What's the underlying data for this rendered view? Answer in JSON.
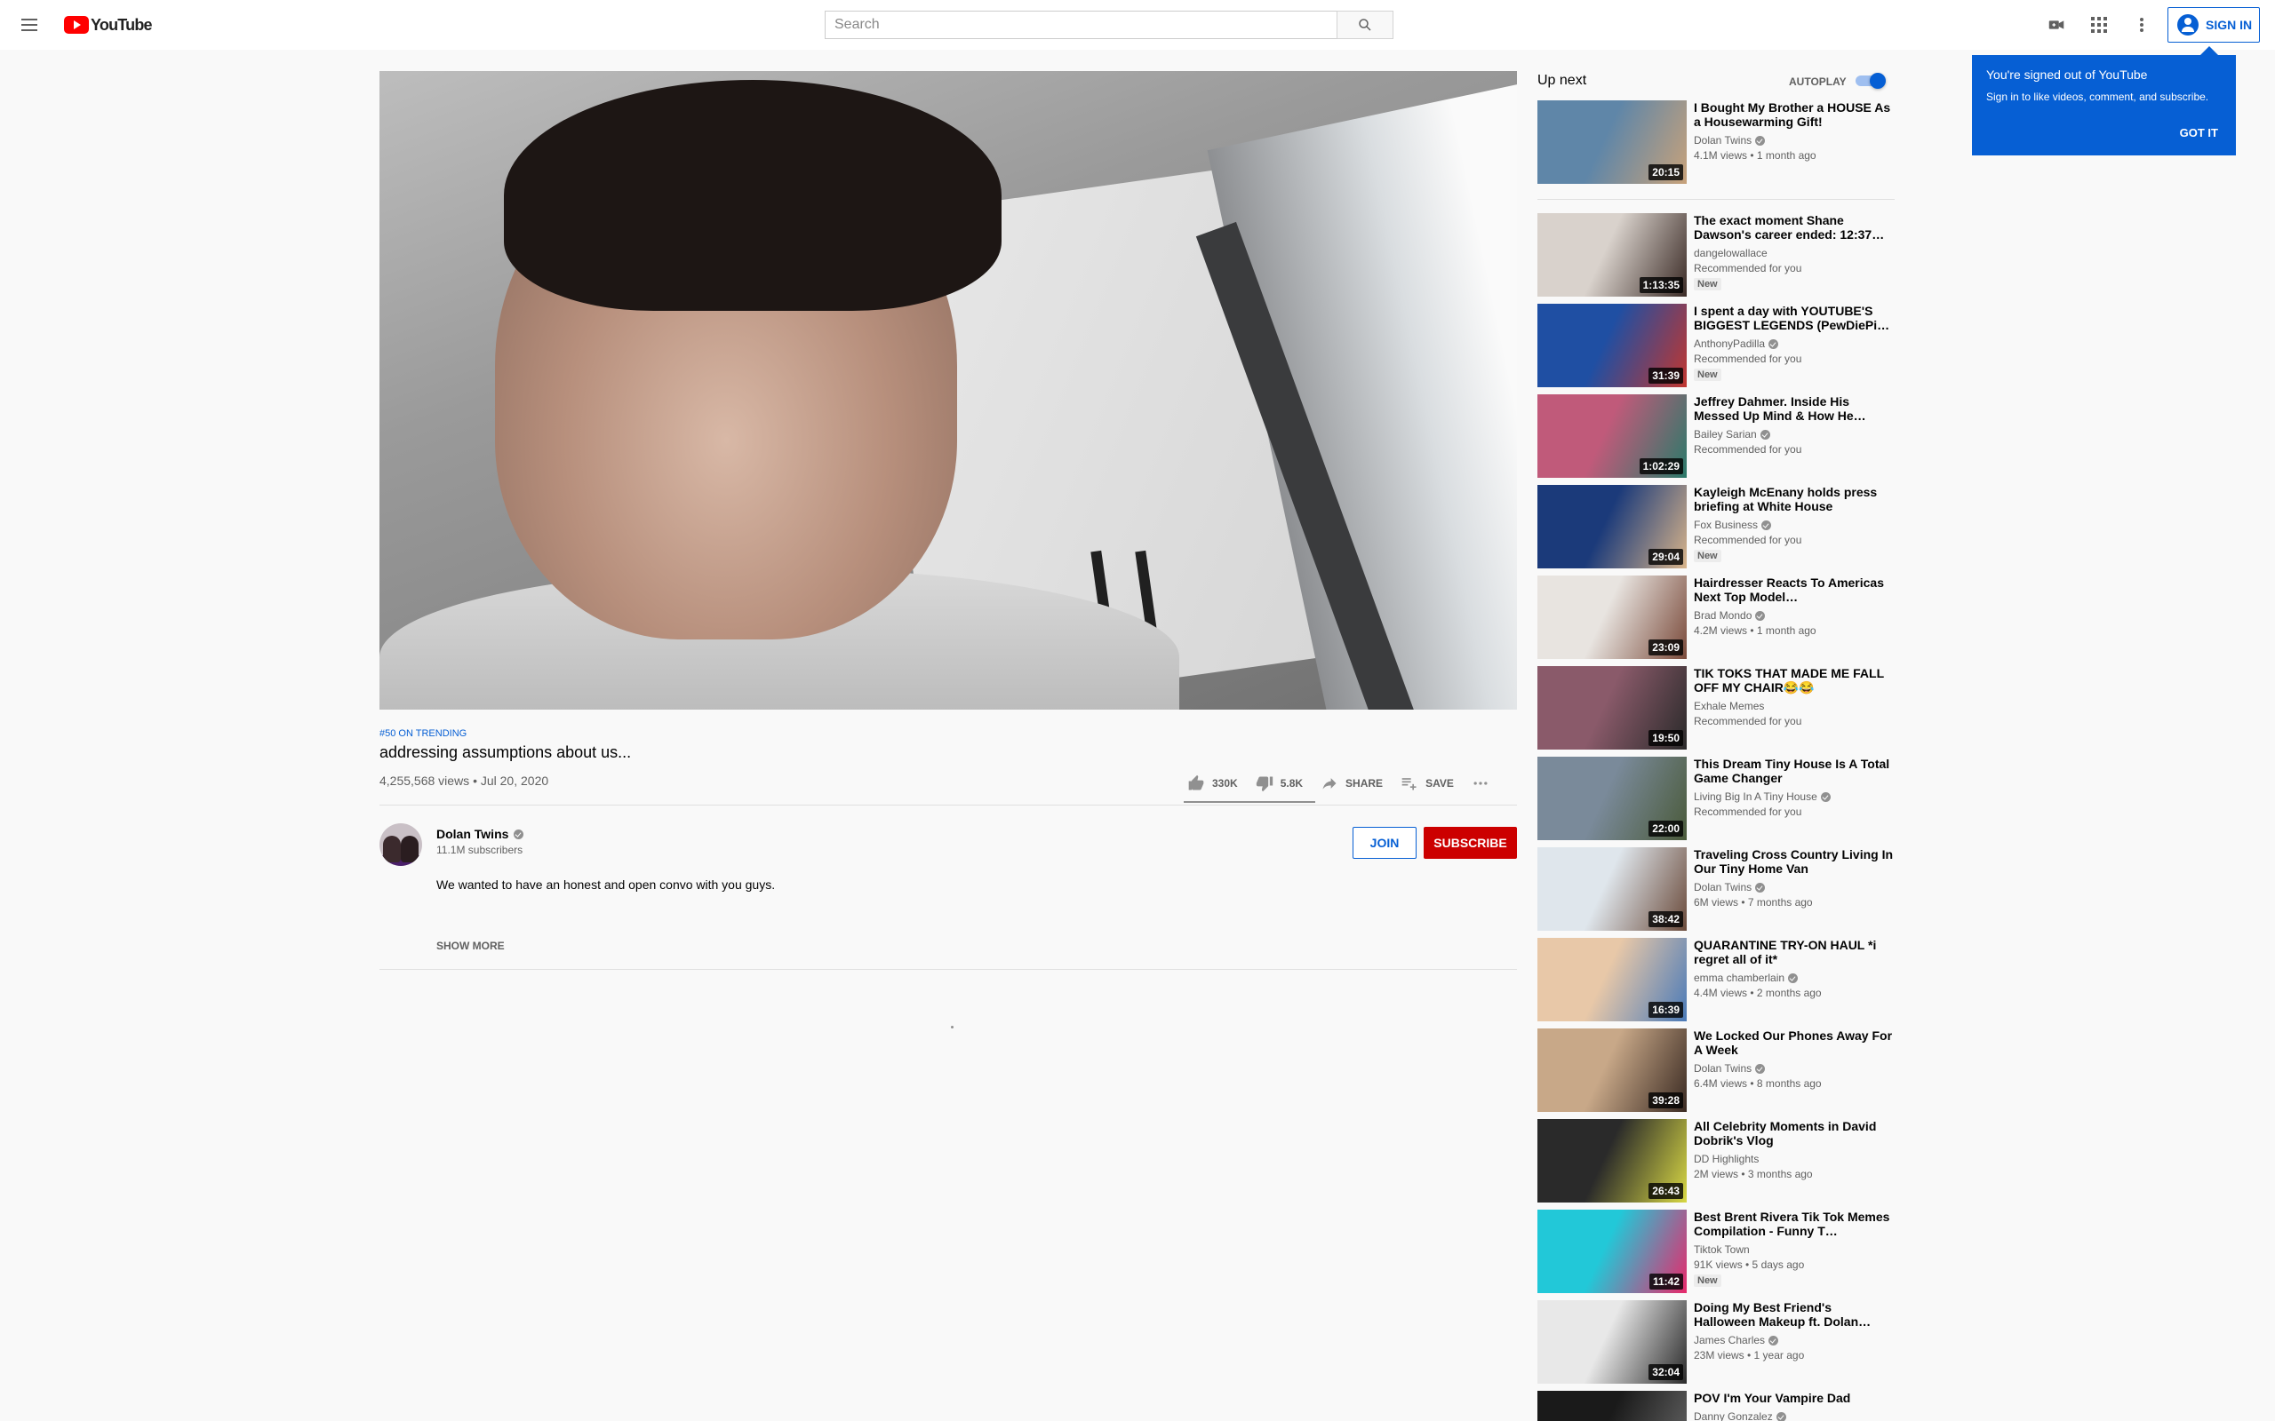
{
  "masthead": {
    "logo_text": "YouTube",
    "search_placeholder": "Search",
    "sign_in_label": "SIGN IN"
  },
  "tooltip": {
    "title": "You're signed out of YouTube",
    "body": "Sign in to like videos, comment, and subscribe.",
    "button": "GOT IT"
  },
  "video": {
    "super_title": "#50 ON TRENDING",
    "title": "addressing assumptions about us...",
    "views_date": "4,255,568 views • Jul 20, 2020",
    "like_count": "330K",
    "dislike_count": "5.8K",
    "share_label": "SHARE",
    "save_label": "SAVE",
    "like_ratio": 0.983
  },
  "owner": {
    "name": "Dolan Twins",
    "subscribers": "11.1M subscribers",
    "join_label": "JOIN",
    "subscribe_label": "SUBSCRIBE",
    "description": "We wanted to have an honest and open convo with you guys.",
    "show_more": "SHOW MORE"
  },
  "sidebar": {
    "up_next_label": "Up next",
    "autoplay_label": "AUTOPLAY",
    "autoplay_on": true,
    "videos": [
      {
        "title": "I Bought My Brother a HOUSE As a Housewarming Gift!",
        "channel": "Dolan Twins",
        "verified": true,
        "line": "4.1M views • 1 month ago",
        "badge": "",
        "duration": "20:15",
        "colors": [
          "#5f86a8",
          "#c8a27a"
        ]
      },
      {
        "title": "The exact moment Shane Dawson's career ended: 12:37…",
        "channel": "dangelowallace",
        "verified": false,
        "line": "Recommended for you",
        "badge": "New",
        "duration": "1:13:35",
        "colors": [
          "#d9d2cc",
          "#3b2b26"
        ]
      },
      {
        "title": "I spent a day with YOUTUBE'S BIGGEST LEGENDS (PewDiePi…",
        "channel": "AnthonyPadilla",
        "verified": true,
        "line": "Recommended for you",
        "badge": "New",
        "duration": "31:39",
        "colors": [
          "#1f4fa3",
          "#c2362f"
        ]
      },
      {
        "title": "Jeffrey Dahmer. Inside His Messed Up Mind & How He…",
        "channel": "Bailey Sarian",
        "verified": true,
        "line": "Recommended for you",
        "badge": "",
        "duration": "1:02:29",
        "colors": [
          "#c05a7a",
          "#2a7a6a"
        ]
      },
      {
        "title": "Kayleigh McEnany holds press briefing at White House",
        "channel": "Fox Business",
        "verified": true,
        "line": "Recommended for you",
        "badge": "New",
        "duration": "29:04",
        "colors": [
          "#1b3a7a",
          "#d8b48a"
        ]
      },
      {
        "title": "Hairdresser Reacts To Americas Next Top Model…",
        "channel": "Brad Mondo",
        "verified": true,
        "line": "4.2M views • 1 month ago",
        "badge": "",
        "duration": "23:09",
        "colors": [
          "#e8e4e0",
          "#7a4a3a"
        ]
      },
      {
        "title": "TIK TOKS THAT MADE ME FALL OFF MY CHAIR😂😂",
        "channel": "Exhale Memes",
        "verified": false,
        "line": "Recommended for you",
        "badge": "",
        "duration": "19:50",
        "colors": [
          "#8a5a6a",
          "#2a2a2a"
        ]
      },
      {
        "title": "This Dream Tiny House Is A Total Game Changer",
        "channel": "Living Big In A Tiny House",
        "verified": true,
        "line": "Recommended for you",
        "badge": "",
        "duration": "22:00",
        "colors": [
          "#7a8a9a",
          "#4a5a3a"
        ]
      },
      {
        "title": "Traveling Cross Country Living In Our Tiny Home Van",
        "channel": "Dolan Twins",
        "verified": true,
        "line": "6M views • 7 months ago",
        "badge": "",
        "duration": "38:42",
        "colors": [
          "#dfe6ec",
          "#6a4a3a"
        ]
      },
      {
        "title": "QUARANTINE TRY-ON HAUL *i regret all of it*",
        "channel": "emma chamberlain",
        "verified": true,
        "line": "4.4M views • 2 months ago",
        "badge": "",
        "duration": "16:39",
        "colors": [
          "#e8c8a8",
          "#4a7ab8"
        ]
      },
      {
        "title": "We Locked Our Phones Away For A Week",
        "channel": "Dolan Twins",
        "verified": true,
        "line": "6.4M views • 8 months ago",
        "badge": "",
        "duration": "39:28",
        "colors": [
          "#c8a888",
          "#3a2a22"
        ]
      },
      {
        "title": "All Celebrity Moments in David Dobrik's Vlog",
        "channel": "DD Highlights",
        "verified": false,
        "line": "2M views • 3 months ago",
        "badge": "",
        "duration": "26:43",
        "colors": [
          "#2a2a2a",
          "#d8d844"
        ]
      },
      {
        "title": "Best Brent Rivera Tik Tok Memes Compilation - Funny T…",
        "channel": "Tiktok Town",
        "verified": false,
        "line": "91K views • 5 days ago",
        "badge": "New",
        "duration": "11:42",
        "colors": [
          "#22c8d8",
          "#e8286a"
        ]
      },
      {
        "title": "Doing My Best Friend's Halloween Makeup ft. Dolan…",
        "channel": "James Charles",
        "verified": true,
        "line": "23M views • 1 year ago",
        "badge": "",
        "duration": "32:04",
        "colors": [
          "#e8e8e8",
          "#2a2a2a"
        ]
      },
      {
        "title": "POV I'm Your Vampire Dad",
        "channel": "Danny Gonzalez",
        "verified": true,
        "line": "",
        "badge": "",
        "duration": "",
        "colors": [
          "#1a1a1a",
          "#6a6a6a"
        ]
      }
    ]
  }
}
